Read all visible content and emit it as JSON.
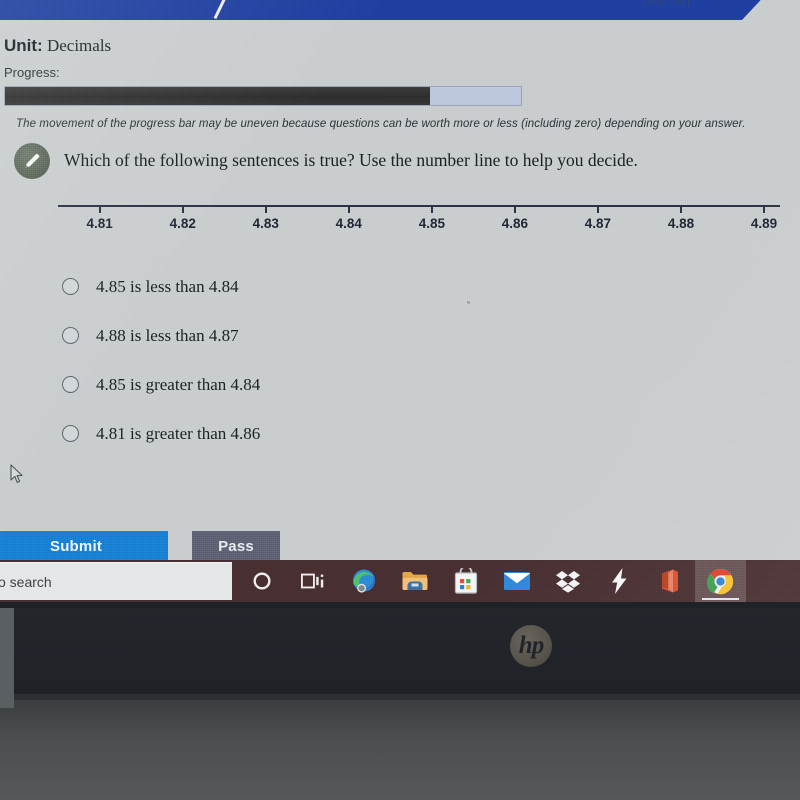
{
  "device": {
    "brand_logo": "hp"
  },
  "banner": {
    "title": "Unit Test"
  },
  "lesson": {
    "unit_prefix": "Unit:",
    "unit_name": "Decimals",
    "progress_label": "Progress:",
    "progress_percent": 82,
    "progress_note": "The movement of the progress bar may be uneven because questions can be worth more or less (including zero) depending on your answer."
  },
  "question": {
    "icon": "pencil-icon",
    "text": "Which of the following sentences is true? Use the number line to help you decide."
  },
  "chart_data": {
    "type": "line",
    "title": "",
    "xlabel": "",
    "ylabel": "",
    "orientation": "horizontal-number-line",
    "grid": false,
    "legend": "none",
    "xlim": [
      4.805,
      4.895
    ],
    "tick_labels": [
      "4.81",
      "4.82",
      "4.83",
      "4.84",
      "4.85",
      "4.86",
      "4.87",
      "4.88",
      "4.89"
    ],
    "tick_values": [
      4.81,
      4.82,
      4.83,
      4.84,
      4.85,
      4.86,
      4.87,
      4.88,
      4.89
    ],
    "tick_positions_pct": [
      4,
      16,
      28,
      40,
      52,
      64,
      76,
      88,
      100
    ],
    "series": [
      {
        "name": "number-line",
        "values": [
          4.81,
          4.82,
          4.83,
          4.84,
          4.85,
          4.86,
          4.87,
          4.88,
          4.89
        ]
      }
    ]
  },
  "answers": {
    "selected": null,
    "options": [
      {
        "id": "a",
        "label": "4.85 is less than 4.84"
      },
      {
        "id": "b",
        "label": "4.88 is less than 4.87"
      },
      {
        "id": "c",
        "label": "4.85 is greater than 4.84"
      },
      {
        "id": "d",
        "label": "4.81 is greater than 4.86"
      }
    ]
  },
  "actions": {
    "submit_label": "Submit",
    "pass_label": "Pass"
  },
  "taskbar": {
    "search_placeholder": "o search",
    "items": [
      {
        "name": "cortana-icon",
        "label": "Cortana",
        "active": false
      },
      {
        "name": "task-view-icon",
        "label": "Task View",
        "active": false
      },
      {
        "name": "edge-icon",
        "label": "Microsoft Edge",
        "active": false
      },
      {
        "name": "file-explorer-icon",
        "label": "File Explorer",
        "active": false
      },
      {
        "name": "microsoft-store-icon",
        "label": "Microsoft Store",
        "active": false
      },
      {
        "name": "mail-icon",
        "label": "Mail",
        "active": false
      },
      {
        "name": "dropbox-icon",
        "label": "Dropbox",
        "active": false
      },
      {
        "name": "lightning-icon",
        "label": "Lightning App",
        "active": false
      },
      {
        "name": "office-icon",
        "label": "Microsoft Office",
        "active": false
      },
      {
        "name": "chrome-icon",
        "label": "Google Chrome",
        "active": true
      }
    ]
  },
  "colors": {
    "banner_blue": "#1f3e9e",
    "submit_blue": "#1a7fd4",
    "pass_gray": "#5e6173",
    "progress_fill": "#2d2d2d",
    "progress_track": "#bcc8de",
    "taskbar": "#472e31",
    "page_bg": "#c9cdce"
  }
}
